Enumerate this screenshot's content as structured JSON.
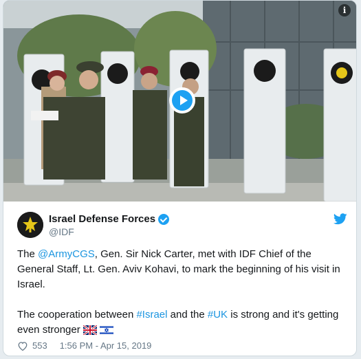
{
  "media": {
    "info_label": "i",
    "play_label": "Play video"
  },
  "tweet": {
    "author_name": "Israel Defense Forces",
    "author_handle": "@IDF",
    "text": {
      "p1_prefix": "The ",
      "p1_mention": "@ArmyCGS",
      "p1_rest": ", Gen. Sir Nick Carter, met with IDF Chief of the General Staff, Lt. Gen. Aviv Kohavi, to mark the beginning of his visit in Israel.",
      "p2_prefix": "The cooperation between ",
      "p2_hashtag1": "#Israel",
      "p2_mid": " and the ",
      "p2_hashtag2": "#UK",
      "p2_rest": " is strong and it's getting even stronger"
    },
    "likes": "553",
    "timestamp": "1:56 PM - Apr 15, 2019"
  },
  "colors": {
    "accent": "#1da1f2",
    "link": "#1b95e0",
    "text": "#14171a",
    "muted": "#657786"
  },
  "icons": [
    "info-icon",
    "play-icon",
    "avatar-logo",
    "verified-badge-icon",
    "twitter-bird-icon",
    "heart-icon",
    "uk-flag-icon",
    "israel-flag-icon"
  ]
}
